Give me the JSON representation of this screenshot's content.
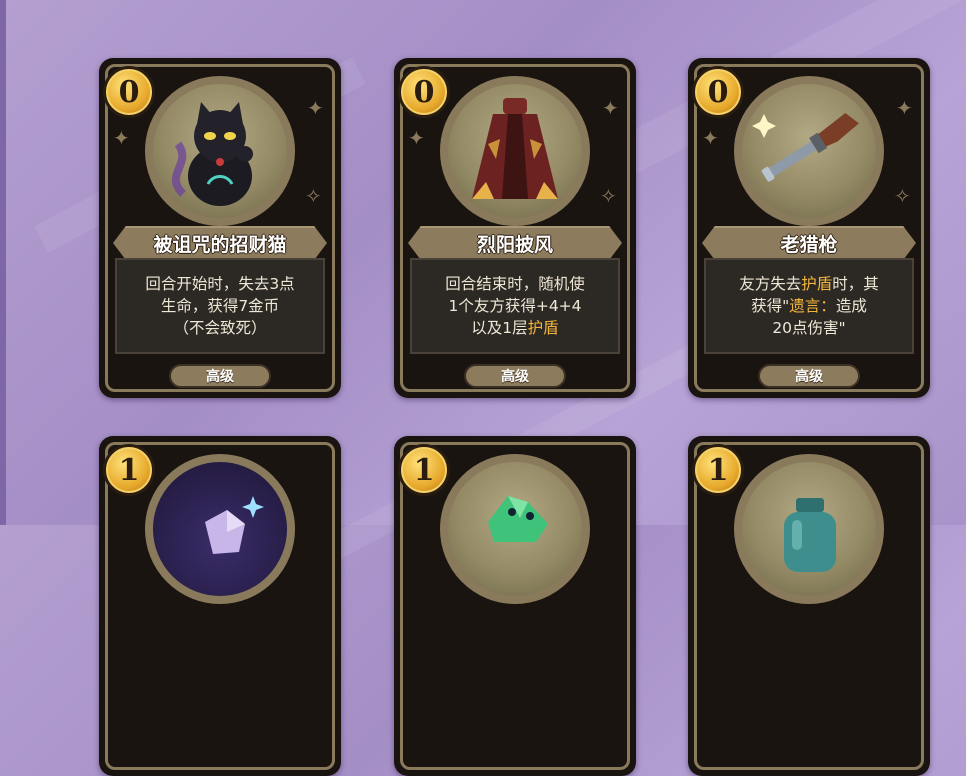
{
  "colors": {
    "card_bg": "#1a1410",
    "frame": "#8a7a5c",
    "highlight": "#f3b63c",
    "background": "#a48ec6"
  },
  "cards": [
    {
      "cost": "0",
      "name": "被诅咒的招财猫",
      "icon": "cursed-lucky-cat-icon",
      "desc_lines": [
        {
          "t": "回合开始时，失去3点"
        },
        {
          "t": "生命，获得7金币"
        },
        {
          "t": "（不会致死）"
        }
      ],
      "rarity": "高级"
    },
    {
      "cost": "0",
      "name": "烈阳披风",
      "icon": "sun-cloak-icon",
      "desc_lines": [
        {
          "t": "回合结束时，随机使"
        },
        {
          "t": "1个友方获得+4+4"
        },
        {
          "t": "以及1层",
          "hl": "护盾"
        }
      ],
      "rarity": "高级"
    },
    {
      "cost": "0",
      "name": "老猎枪",
      "icon": "old-musket-icon",
      "desc_lines": [
        {
          "t": "友方失去",
          "hl": "护盾",
          "t2": "时，其"
        },
        {
          "t": "获得\"",
          "hl": "遗言：",
          "t2": "造成"
        },
        {
          "t": "20点伤害\""
        }
      ],
      "rarity": "高级"
    },
    {
      "cost": "1",
      "icon": "crystal-gem-icon"
    },
    {
      "cost": "1",
      "icon": "green-frog-icon"
    },
    {
      "cost": "1",
      "icon": "teal-jar-icon"
    }
  ]
}
